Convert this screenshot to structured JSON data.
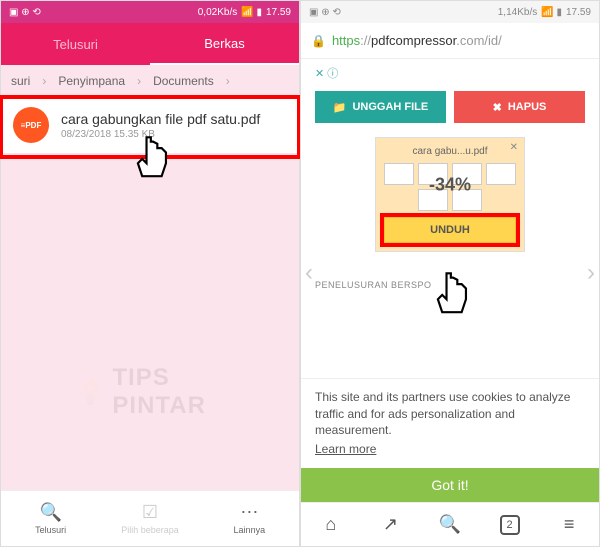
{
  "left": {
    "status": {
      "speed": "0,02Kb/s",
      "time": "17.59"
    },
    "tabs": {
      "browse": "Telusuri",
      "files": "Berkas"
    },
    "crumbs": {
      "a": "suri",
      "b": "Penyimpana",
      "c": "Documents"
    },
    "file": {
      "name": "cara gabungkan file pdf satu.pdf",
      "meta": "08/23/2018 15.35     KB"
    },
    "nav": {
      "browse": "Telusuri",
      "select": "Pilih beberapa",
      "more": "Lainnya"
    }
  },
  "right": {
    "status": {
      "speed": "1,14Kb/s",
      "time": "17.59"
    },
    "url": {
      "https": "https",
      "sep": "://",
      "domain": "pdfcompressor",
      "rest": ".com/id/"
    },
    "adclose": "✕ ⓘ",
    "upload": "UNGGAH FILE",
    "delete": "HAPUS",
    "preview": {
      "title": "cara gabu...u.pdf",
      "percent": "-34%"
    },
    "download": "UNDUH",
    "searchlabel": "PENELUSURAN BERSPO",
    "cookie": "This site and its partners use cookies to analyze traffic and for ads personalization and measurement.",
    "learn": "Learn more",
    "gotit": "Got it!",
    "tabcount": "2"
  },
  "watermark": "TIPS PINTAR"
}
